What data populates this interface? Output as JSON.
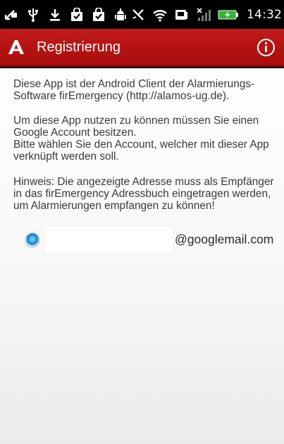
{
  "status_bar": {
    "time": "14:32",
    "icons": [
      "missed-call-icon",
      "usb-icon",
      "download-icon",
      "bag-check-icon",
      "bag-check-icon",
      "android-update-icon",
      "vibrate-icon",
      "wifi-icon",
      "nfc-icon",
      "signal-icon",
      "battery-charging-icon"
    ]
  },
  "action_bar": {
    "title": "Registrierung",
    "info_icon": "info-icon",
    "logo_icon": "alamos-logo-icon",
    "background": "#b81414"
  },
  "content": {
    "paragraph1": "Diese App ist der Android Client der Alarmierungs-Software firEmergency (http://alamos-ug.de).",
    "paragraph2_line1": "Um diese App nutzen zu können müssen Sie einen Google Account besitzen.",
    "paragraph2_line2": "Bitte wählen Sie den Account, welcher mit dieser App verknüpft werden soll.",
    "paragraph3": "Hinweis: Die angezeigte Adresse muss als Empfänger in das firEmergency Adressbuch eingetragen werden, um Alarmierungen empfangen zu können!"
  },
  "account": {
    "selected": true,
    "input_value": "",
    "domain_suffix": "@googlemail.com"
  }
}
